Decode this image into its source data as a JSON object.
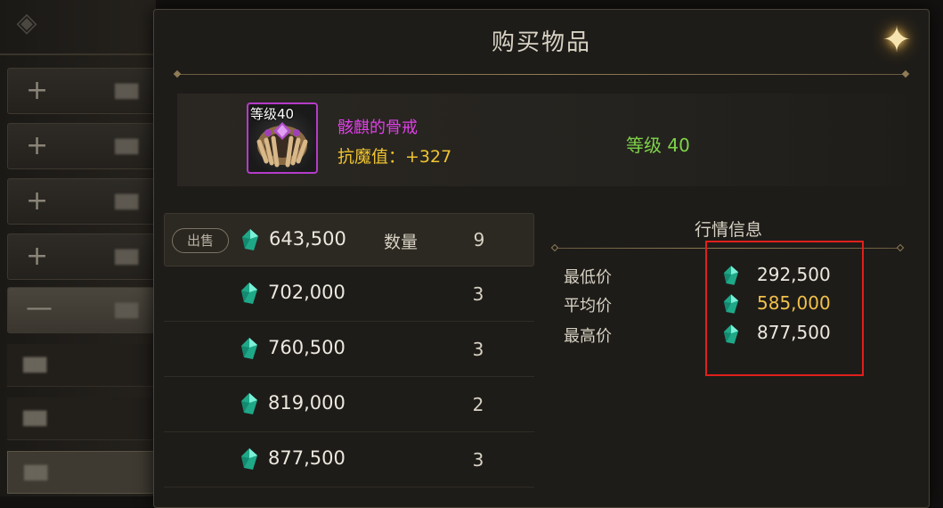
{
  "dialog": {
    "title": "购买物品"
  },
  "item": {
    "icon_level": "等级40",
    "name": "骸麒的骨戒",
    "stat_label": "抗魔值：",
    "stat_value": "+327",
    "level_label": "等级",
    "level_value": "40",
    "rarity_color": "#b43cc8"
  },
  "listings": {
    "sell_label": "出售",
    "qty_label": "数量",
    "rows": [
      {
        "price": "643,500",
        "qty": "9"
      },
      {
        "price": "702,000",
        "qty": "3"
      },
      {
        "price": "760,500",
        "qty": "3"
      },
      {
        "price": "819,000",
        "qty": "2"
      },
      {
        "price": "877,500",
        "qty": "3"
      }
    ]
  },
  "market": {
    "title": "行情信息",
    "min_label": "最低价",
    "min_value": "292,500",
    "avg_label": "平均价",
    "avg_value": "585,000",
    "max_label": "最高价",
    "max_value": "877,500"
  },
  "colors": {
    "currency_gem": "#2fd6b0",
    "highlight_box": "#e0201c",
    "level_green": "#7ed34a",
    "stat_gold": "#f0c430"
  },
  "icons": {
    "currency": "gem-icon",
    "close": "sparkle-close-icon",
    "plus": "plus-icon",
    "minus": "minus-icon"
  }
}
